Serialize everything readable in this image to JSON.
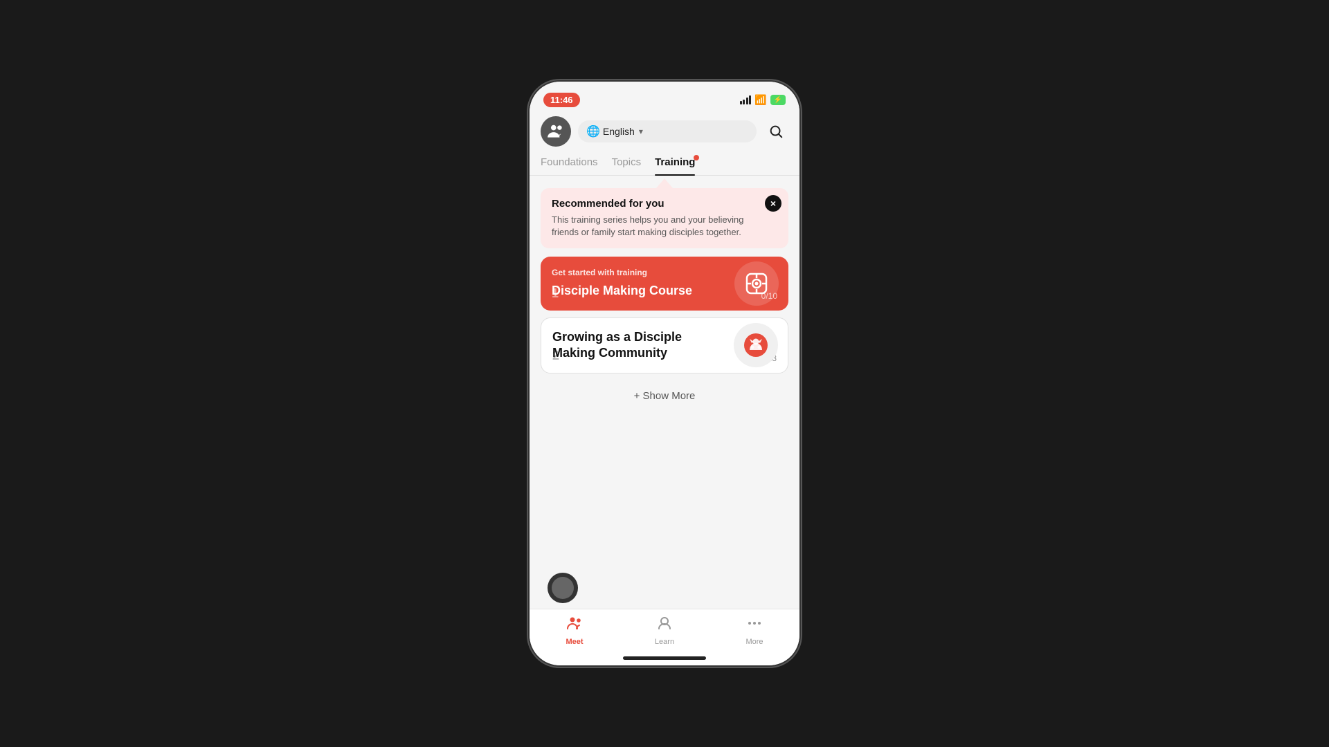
{
  "statusBar": {
    "time": "11:46",
    "batteryLabel": "⚡"
  },
  "header": {
    "avatarIcon": "👥",
    "language": "English",
    "searchIcon": "🔍"
  },
  "tabs": [
    {
      "label": "Foundations",
      "active": false
    },
    {
      "label": "Topics",
      "active": false
    },
    {
      "label": "Training",
      "active": true
    }
  ],
  "recommendationBanner": {
    "title": "Recommended for you",
    "description": "This training series helps you and your believing friends or family start making disciples together.",
    "closeLabel": "×"
  },
  "courses": [
    {
      "id": 1,
      "sectionLabel": "Get started with training",
      "title": "Disciple Making Course",
      "number": "1",
      "progress": "0/10",
      "variant": "red",
      "iconChar": "⊙"
    },
    {
      "id": 2,
      "sectionLabel": "",
      "title": "Growing as a Disciple Making Community",
      "number": "2",
      "progress": "0/13",
      "variant": "white",
      "iconChar": "🦊"
    }
  ],
  "showMore": "+ Show More",
  "bottomTabs": [
    {
      "label": "Meet",
      "active": true,
      "icon": "meet"
    },
    {
      "label": "Learn",
      "active": false,
      "icon": "learn"
    },
    {
      "label": "More",
      "active": false,
      "icon": "more"
    }
  ]
}
